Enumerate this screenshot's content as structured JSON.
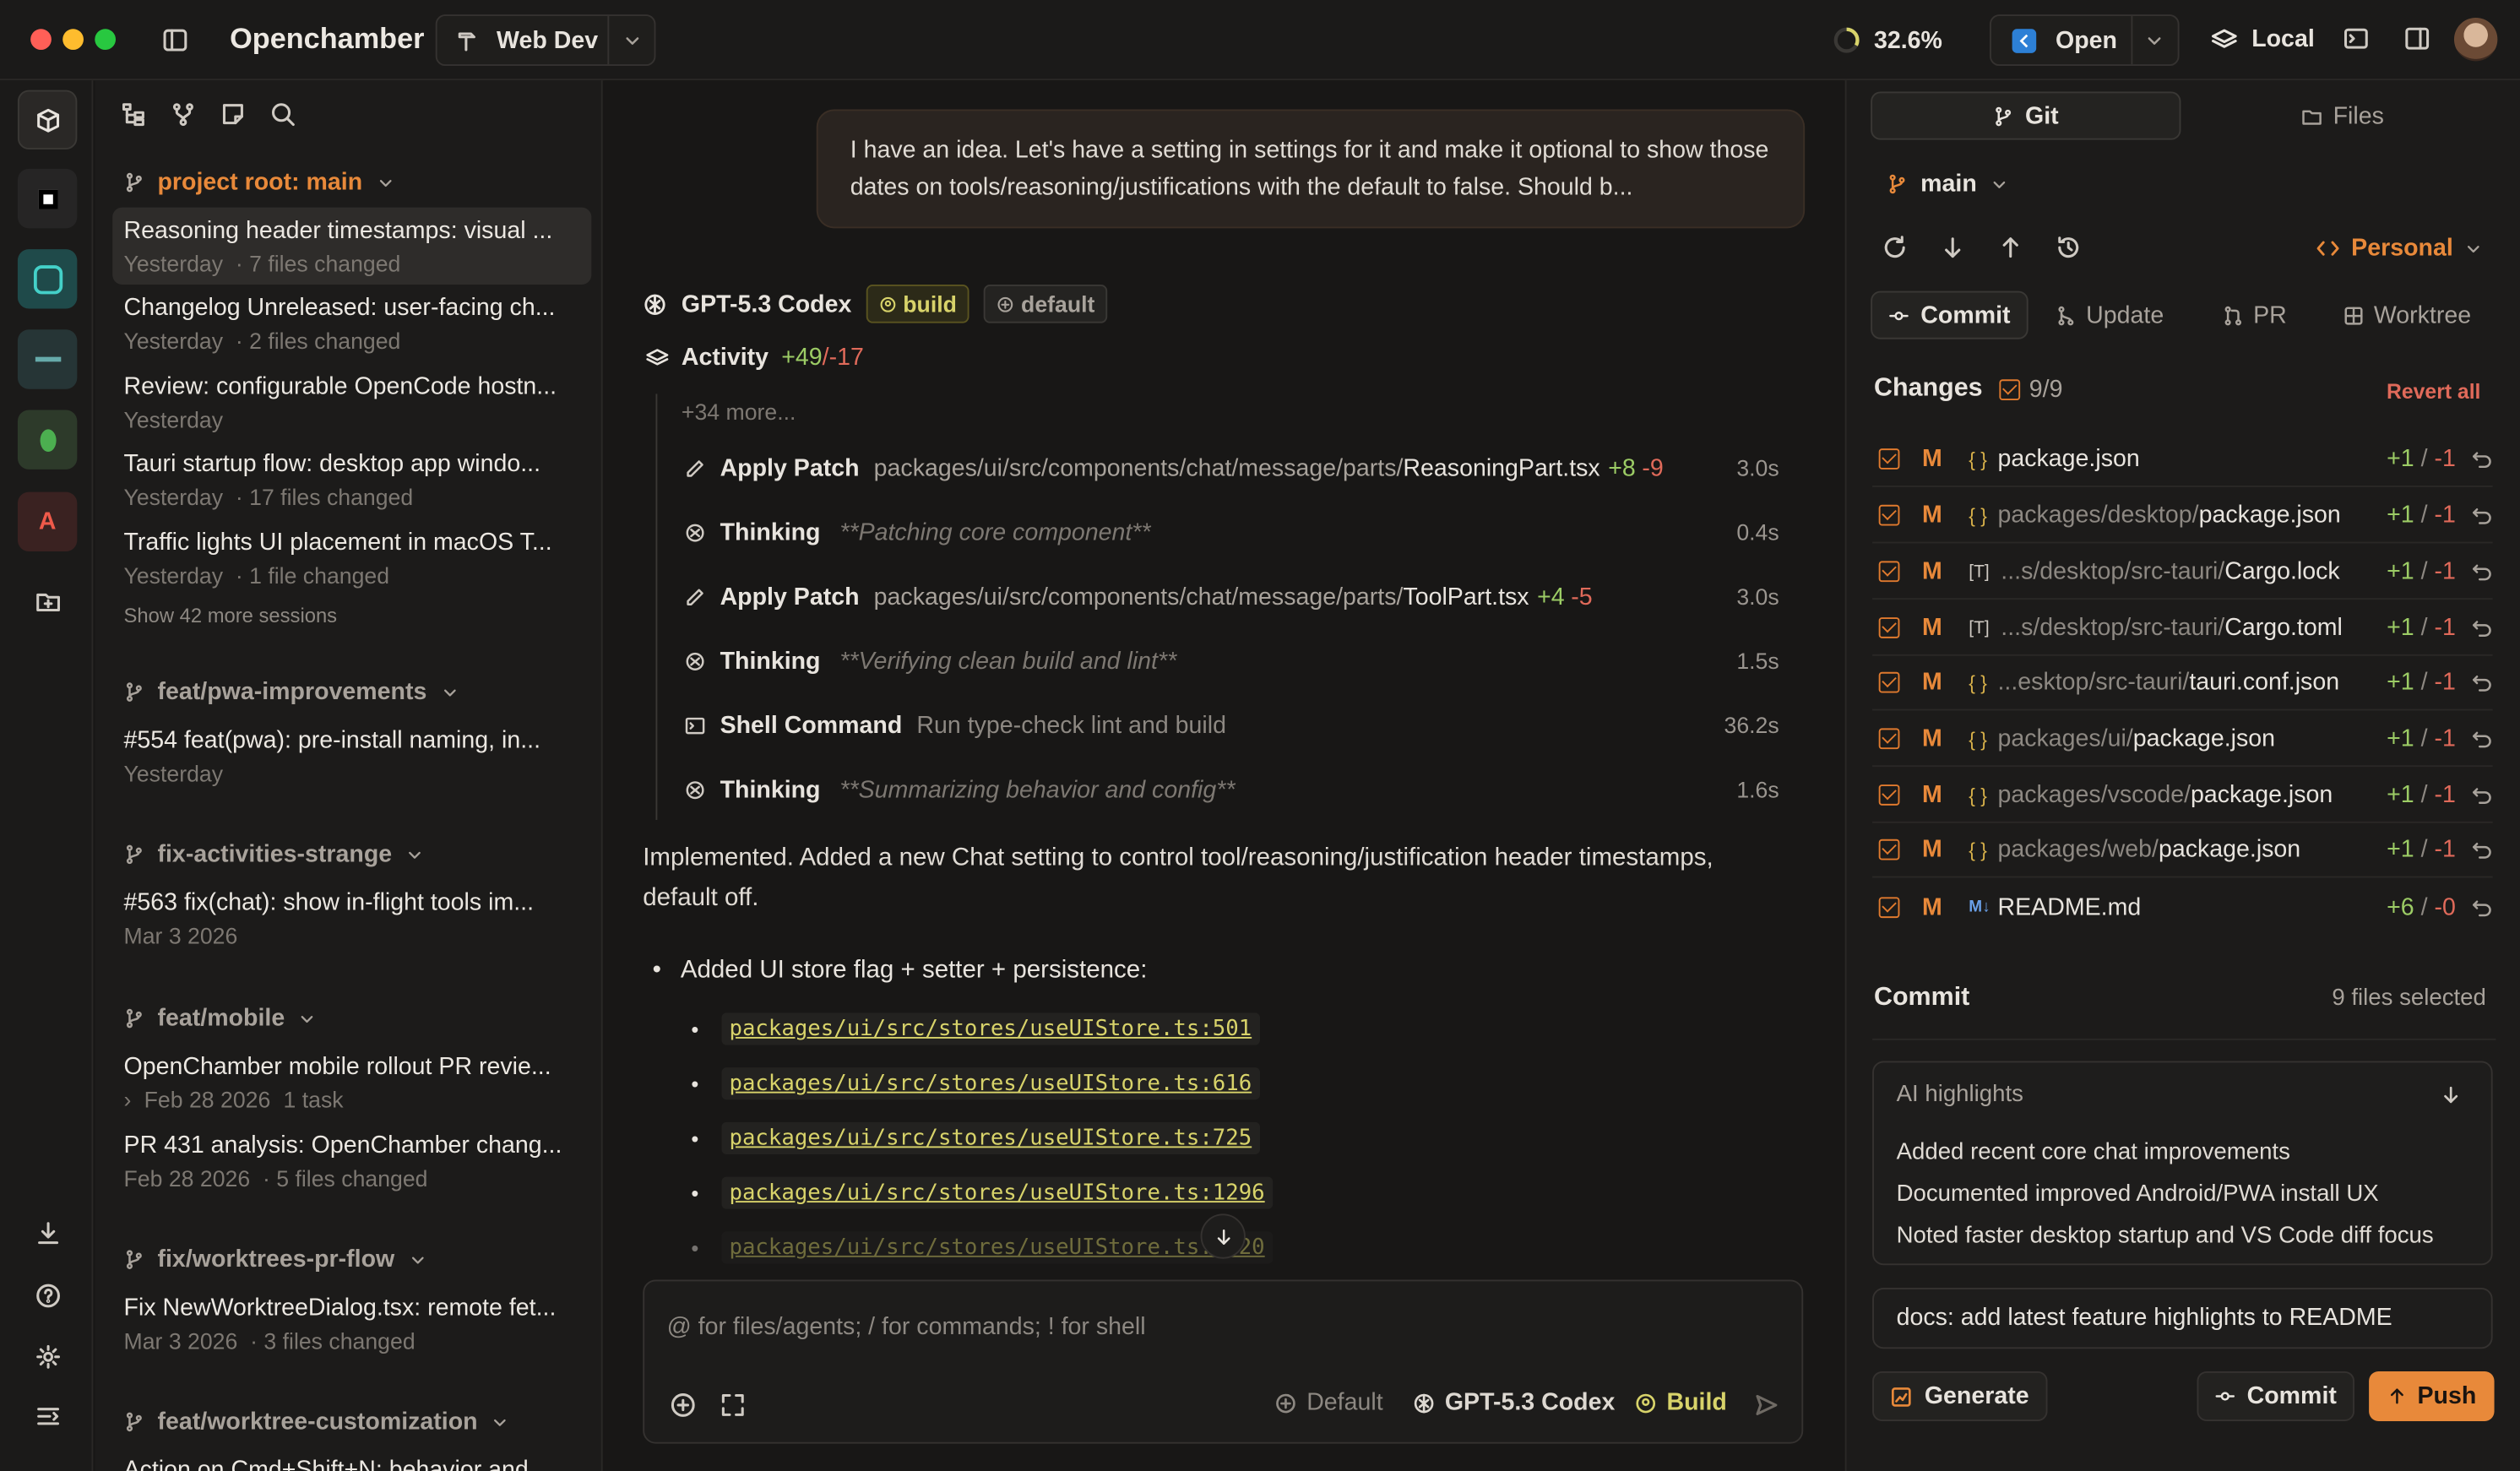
{
  "app": {
    "title": "Openchamber",
    "project": "Web Dev",
    "usage": "32.6%",
    "open_label": "Open",
    "local_label": "Local"
  },
  "sessions": {
    "root_branch": "project root: main",
    "root_items": [
      {
        "title": "Reasoning header timestamps: visual ...",
        "when": "Yesterday",
        "meta": "· 7 files changed"
      },
      {
        "title": "Changelog Unreleased: user-facing ch...",
        "when": "Yesterday",
        "meta": "· 2 files changed"
      },
      {
        "title": "Review: configurable OpenCode hostn...",
        "when": "Yesterday",
        "meta": ""
      },
      {
        "title": "Tauri startup flow: desktop app windo...",
        "when": "Yesterday",
        "meta": "· 17 files changed"
      },
      {
        "title": "Traffic lights UI placement in macOS T...",
        "when": "Yesterday",
        "meta": "· 1 file changed"
      }
    ],
    "show_more": "Show 42 more sessions",
    "groups": [
      {
        "branch": "feat/pwa-improvements",
        "title": "#554 feat(pwa): pre-install naming, in...",
        "when": "Yesterday",
        "meta": ""
      },
      {
        "branch": "fix-activities-strange",
        "title": "#563 fix(chat): show in-flight tools im...",
        "when": "Mar 3 2026",
        "meta": ""
      },
      {
        "branch": "feat/mobile",
        "title": "OpenChamber mobile rollout PR revie...",
        "when": "Feb 28 2026",
        "meta": "1 task",
        "title2": "PR 431 analysis: OpenChamber chang...",
        "when2": "Feb 28 2026",
        "meta2": "· 5 files changed"
      },
      {
        "branch": "fix/worktrees-pr-flow",
        "title": "Fix NewWorktreeDialog.tsx: remote fet...",
        "when": "Mar 3 2026",
        "meta": "· 3 files changed"
      },
      {
        "branch": "feat/worktree-customization",
        "title": "Action on Cmd+Shift+N: behavior and...",
        "when": "",
        "meta": ""
      }
    ]
  },
  "chat": {
    "user_message": "I have an idea. Let's have a setting in settings for it and make it optional to show those dates on tools/reasoning/justifications with the default to false. Should b...",
    "model": "GPT-5.3 Codex",
    "agent_badge": "build",
    "variant_badge": "default",
    "activity_label": "Activity",
    "activity_add": "+49",
    "activity_del": "/-17",
    "more": "+34 more...",
    "activities": [
      {
        "kind": "Apply Patch",
        "path": "packages/ui/src/components/chat/message/parts/",
        "file": "ReasoningPart.tsx",
        "add": "+8",
        "del": "-9",
        "time": "3.0s",
        "icon": "pencil-icon"
      },
      {
        "kind": "Thinking",
        "note": "**Patching core component**",
        "time": "0.4s",
        "icon": "thinking-icon"
      },
      {
        "kind": "Apply Patch",
        "path": "packages/ui/src/components/chat/message/parts/",
        "file": "ToolPart.tsx",
        "add": "+4",
        "del": "-5",
        "time": "3.0s",
        "icon": "pencil-icon"
      },
      {
        "kind": "Thinking",
        "note": "**Verifying clean build and lint**",
        "time": "1.5s",
        "icon": "thinking-icon"
      },
      {
        "kind": "Shell Command",
        "note": "Run type-check lint and build",
        "time": "36.2s",
        "icon": "terminal-icon"
      },
      {
        "kind": "Thinking",
        "note": "**Summarizing behavior and config**",
        "time": "1.6s",
        "icon": "thinking-icon"
      }
    ],
    "answer": "Implemented. Added a new Chat setting to control tool/reasoning/justification header timestamps, default off.",
    "bullet": "Added UI store flag + setter + persistence:",
    "links": [
      "packages/ui/src/stores/useUIStore.ts:501",
      "packages/ui/src/stores/useUIStore.ts:616",
      "packages/ui/src/stores/useUIStore.ts:725",
      "packages/ui/src/stores/useUIStore.ts:1296",
      "packages/ui/src/stores/useUIStore.ts:1320"
    ],
    "input_placeholder": "@ for files/agents; / for commands; ! for shell",
    "footer_variant": "Default",
    "footer_model": "GPT-5.3 Codex",
    "footer_agent": "Build"
  },
  "git": {
    "tab_git": "Git",
    "tab_files": "Files",
    "branch": "main",
    "identity": "Personal",
    "actions": [
      "Commit",
      "Update",
      "PR",
      "Worktree"
    ],
    "changes_label": "Changes",
    "changes_count": "9/9",
    "revert_all": "Revert all",
    "files": [
      {
        "status": "M",
        "prefix": "",
        "name": "package.json",
        "add": "+1",
        "del": "-1",
        "icon": "json"
      },
      {
        "status": "M",
        "prefix": "packages/desktop/",
        "name": "package.json",
        "add": "+1",
        "del": "-1",
        "icon": "json"
      },
      {
        "status": "M",
        "prefix": "...s/desktop/src-tauri/",
        "name": "Cargo.lock",
        "add": "+1",
        "del": "-1",
        "icon": "text"
      },
      {
        "status": "M",
        "prefix": "...s/desktop/src-tauri/",
        "name": "Cargo.toml",
        "add": "+1",
        "del": "-1",
        "icon": "text"
      },
      {
        "status": "M",
        "prefix": "...esktop/src-tauri/",
        "name": "tauri.conf.json",
        "add": "+1",
        "del": "-1",
        "icon": "json"
      },
      {
        "status": "M",
        "prefix": "packages/ui/",
        "name": "package.json",
        "add": "+1",
        "del": "-1",
        "icon": "json"
      },
      {
        "status": "M",
        "prefix": "packages/vscode/",
        "name": "package.json",
        "add": "+1",
        "del": "-1",
        "icon": "json"
      },
      {
        "status": "M",
        "prefix": "packages/web/",
        "name": "package.json",
        "add": "+1",
        "del": "-1",
        "icon": "json"
      },
      {
        "status": "M",
        "prefix": "",
        "name": "README.md",
        "add": "+6",
        "del": "-0",
        "icon": "markdown"
      }
    ],
    "commit_label": "Commit",
    "selected": "9 files selected",
    "ai_title": "AI highlights",
    "highlights": [
      "Added recent core chat improvements",
      "Documented improved Android/PWA install UX",
      "Noted faster desktop startup and VS Code diff focus"
    ],
    "commit_message": "docs: add latest feature highlights to README",
    "generate": "Generate",
    "commit_btn": "Commit",
    "push": "Push"
  },
  "colors": {
    "accent": "#e8893a",
    "added": "#9ccc65",
    "removed": "#e06a5a",
    "background": "#181716"
  }
}
